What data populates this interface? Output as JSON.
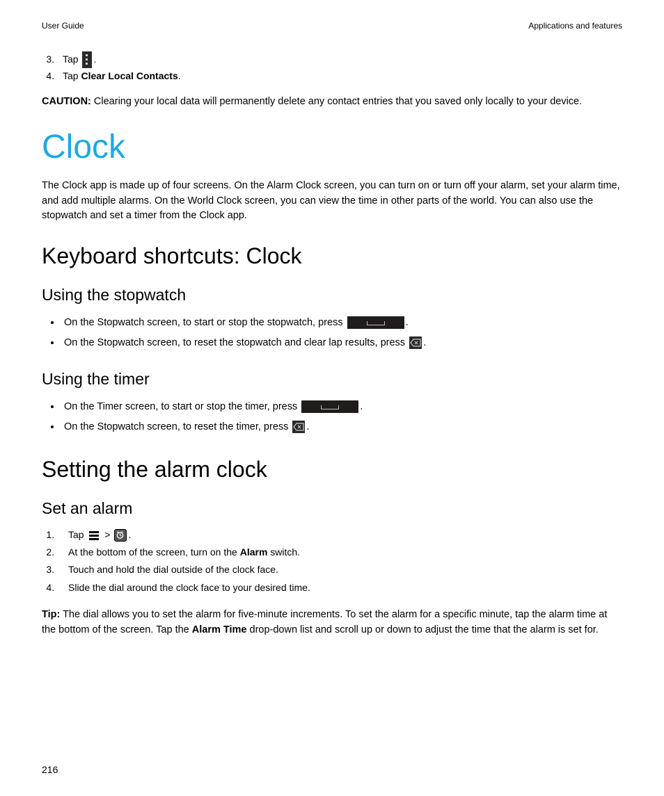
{
  "header": {
    "left": "User Guide",
    "right": "Applications and features"
  },
  "topSteps": {
    "item3_text": "Tap ",
    "item3_period": ".",
    "item4_prefix": "Tap ",
    "item4_bold": "Clear Local Contacts",
    "item4_period": "."
  },
  "caution": {
    "label": "CAUTION:",
    "text": " Clearing your local data will permanently delete any contact entries that you saved only locally to your device."
  },
  "clock": {
    "title": "Clock",
    "intro": "The Clock app is made up of four screens. On the Alarm Clock screen, you can turn on or turn off your alarm, set your alarm time, and add multiple alarms. On the World Clock screen, you can view the time in other parts of the world. You can also use the stopwatch and set a timer from the Clock app."
  },
  "kbShortcuts": {
    "title": "Keyboard shortcuts: Clock",
    "stopwatch": {
      "title": "Using the stopwatch",
      "b1_prefix": "On the Stopwatch screen, to start or stop the stopwatch, press ",
      "b1_suffix": ".",
      "b2_prefix": "On the Stopwatch screen, to reset the stopwatch and clear lap results, press ",
      "b2_suffix": "."
    },
    "timer": {
      "title": "Using the timer",
      "b1_prefix": "On the Timer screen, to start or stop the timer, press ",
      "b1_suffix": ".",
      "b2_prefix": "On the Stopwatch screen, to reset the timer, press ",
      "b2_suffix": "."
    }
  },
  "settingAlarm": {
    "title": "Setting the alarm clock",
    "setAlarm": {
      "title": "Set an alarm",
      "s1_prefix": "Tap ",
      "s1_gt": " > ",
      "s1_suffix": ".",
      "s2_prefix": "At the bottom of the screen, turn on the ",
      "s2_bold": "Alarm",
      "s2_suffix": " switch.",
      "s3": "Touch and hold the dial outside of the clock face.",
      "s4": "Slide the dial around the clock face to your desired time."
    }
  },
  "tip": {
    "label": "Tip:",
    "part1": " The dial allows you to set the alarm for five-minute increments. To set the alarm for a specific minute, tap the alarm time at the bottom of the screen. Tap the ",
    "bold": "Alarm Time",
    "part2": " drop-down list and scroll up or down to adjust the time that the alarm is set for."
  },
  "pageNumber": "216"
}
